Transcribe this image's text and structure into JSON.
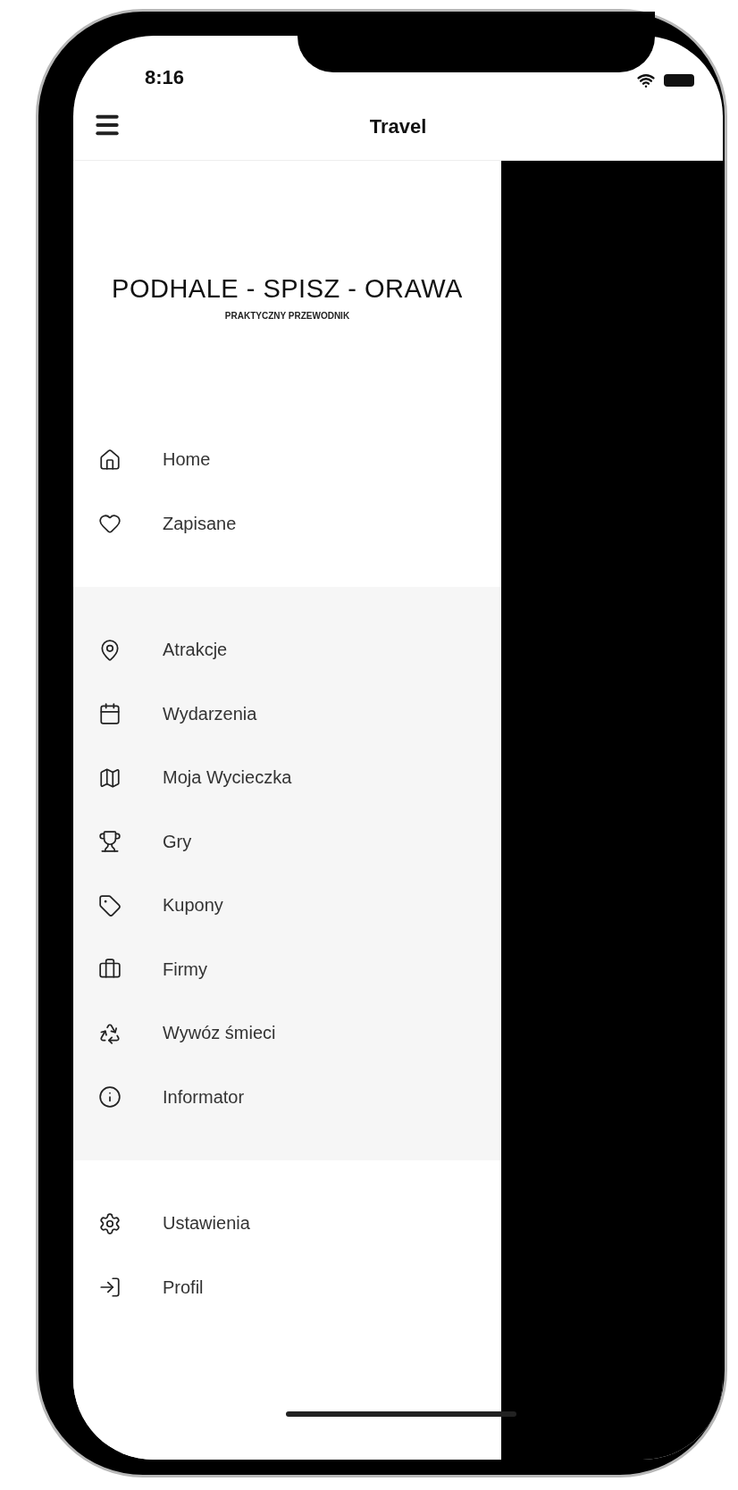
{
  "status_bar": {
    "time": "8:16"
  },
  "header": {
    "title": "Travel"
  },
  "drawer": {
    "logo": {
      "title": "PODHALE - SPISZ - ORAWA",
      "subtitle": "PRAKTYCZNY PRZEWODNIK"
    },
    "sections": [
      {
        "items": [
          {
            "label": "Home"
          },
          {
            "label": "Zapisane"
          }
        ]
      },
      {
        "items": [
          {
            "label": "Atrakcje"
          },
          {
            "label": "Wydarzenia"
          },
          {
            "label": "Moja Wycieczka"
          },
          {
            "label": "Gry"
          },
          {
            "label": "Kupony"
          },
          {
            "label": "Firmy"
          },
          {
            "label": "Wywóz śmieci"
          },
          {
            "label": "Informator"
          }
        ]
      },
      {
        "items": [
          {
            "label": "Ustawienia"
          },
          {
            "label": "Profil"
          }
        ]
      }
    ]
  }
}
